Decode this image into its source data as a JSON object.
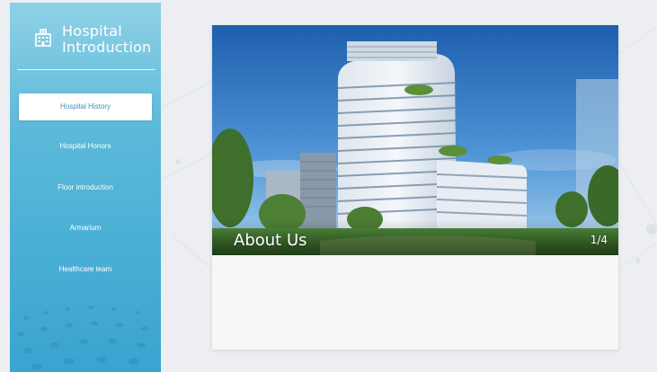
{
  "sidebar": {
    "title": "Hospital\nIntroduction",
    "icon": "hospital-building-icon",
    "items": [
      {
        "label": "Hospital History",
        "active": true
      },
      {
        "label": "Hospital Honors",
        "active": false
      },
      {
        "label": "Floor introduction",
        "active": false
      },
      {
        "label": "Armarium",
        "active": false
      },
      {
        "label": "Healthcare team",
        "active": false
      }
    ]
  },
  "banner": {
    "title": "About Us",
    "counter": "1/4"
  },
  "colors": {
    "sidebar_top": "#8fd1e6",
    "sidebar_bottom": "#3aa3cf",
    "active_text": "#3a8fbc",
    "page_bg": "#eceef2"
  }
}
